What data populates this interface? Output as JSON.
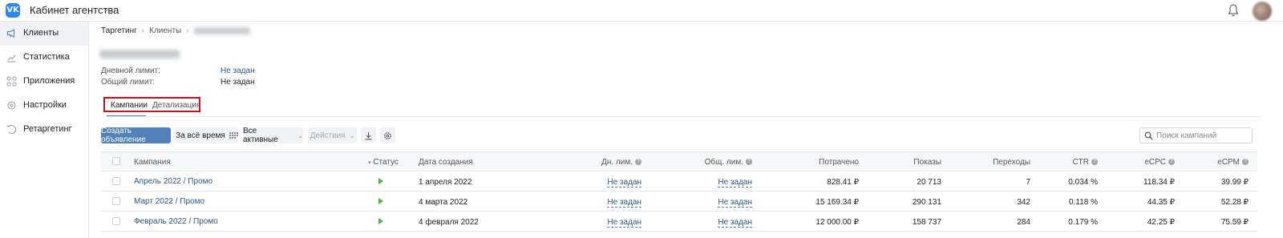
{
  "header": {
    "logo_text": "VK",
    "title": "Кабинет агентства"
  },
  "sidebar": {
    "items": [
      {
        "label": "Клиенты",
        "icon": "megaphone-icon",
        "active": true
      },
      {
        "label": "Статистика",
        "icon": "chart-line-icon",
        "active": false
      },
      {
        "label": "Приложения",
        "icon": "apps-grid-icon",
        "active": false
      },
      {
        "label": "Настройки",
        "icon": "gear-icon",
        "active": false
      },
      {
        "label": "Ретаргетинг",
        "icon": "retarget-icon",
        "active": false
      }
    ]
  },
  "breadcrumb": {
    "items": [
      "Таргетинг",
      "Клиенты"
    ]
  },
  "client": {
    "daily_limit_label": "Дневной лимит:",
    "daily_limit_value": "Не задан",
    "total_limit_label": "Общий лимит:",
    "total_limit_value": "Не задан"
  },
  "tabs": [
    {
      "label": "Кампании",
      "active": true
    },
    {
      "label": "Детализация",
      "active": false
    }
  ],
  "toolbar": {
    "create_label": "Создать объявление",
    "period_label": "За всё время",
    "filter_label": "Все активные",
    "actions_label": "Действия",
    "search_placeholder": "Поиск кампаний"
  },
  "table": {
    "headers": {
      "campaign": "Кампания",
      "status": "Статус",
      "created": "Дата создания",
      "daily": "Дн. лим.",
      "total": "Общ. лим.",
      "spent": "Потрачено",
      "impressions": "Показы",
      "clicks": "Переходы",
      "ctr": "CTR",
      "ecpc": "eCPC",
      "ecpm": "eCPM"
    },
    "rows": [
      {
        "campaign": "Апрель 2022 / Промо",
        "created": "1 апреля 2022",
        "daily": "Не задан",
        "total": "Не задан",
        "spent": "828.41 ₽",
        "impressions": "20 713",
        "clicks": "7",
        "ctr": "0.034 %",
        "ecpc": "118.34 ₽",
        "ecpm": "39.99 ₽"
      },
      {
        "campaign": "Март 2022 / Промо",
        "created": "4 марта 2022",
        "daily": "Не задан",
        "total": "Не задан",
        "spent": "15 169.34 ₽",
        "impressions": "290 131",
        "clicks": "342",
        "ctr": "0.118 %",
        "ecpc": "44.35 ₽",
        "ecpm": "52.28 ₽"
      },
      {
        "campaign": "Февраль 2022 / Промо",
        "created": "4 февраля 2022",
        "daily": "Не задан",
        "total": "Не задан",
        "spent": "12 000.00 ₽",
        "impressions": "158 737",
        "clicks": "284",
        "ctr": "0.179 %",
        "ecpc": "42.25 ₽",
        "ecpm": "75.59 ₽"
      }
    ]
  },
  "colors": {
    "accent": "#5181b8",
    "link": "#2a5885",
    "status_active": "#4bb34b",
    "highlight_box": "#d10f1b"
  }
}
